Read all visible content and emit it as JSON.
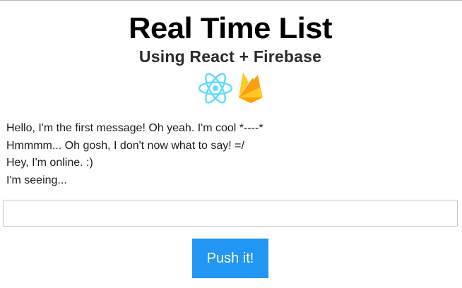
{
  "header": {
    "title": "Real Time List",
    "subtitle": "Using React + Firebase",
    "logos": {
      "react_icon": "react-atom-icon",
      "firebase_icon": "firebase-flame-icon",
      "react_color": "#61dafb",
      "firebase_colors": [
        "#ffca28",
        "#ffa000",
        "#f57c00"
      ]
    }
  },
  "messages": [
    "Hello, I'm the first message! Oh yeah. I'm cool *----*",
    "Hmmmm... Oh gosh, I don't now what to say! =/",
    "Hey, I'm online. :)",
    "I'm seeing..."
  ],
  "input": {
    "value": "",
    "placeholder": ""
  },
  "button": {
    "label": "Push it!",
    "color": "#2196f3"
  }
}
